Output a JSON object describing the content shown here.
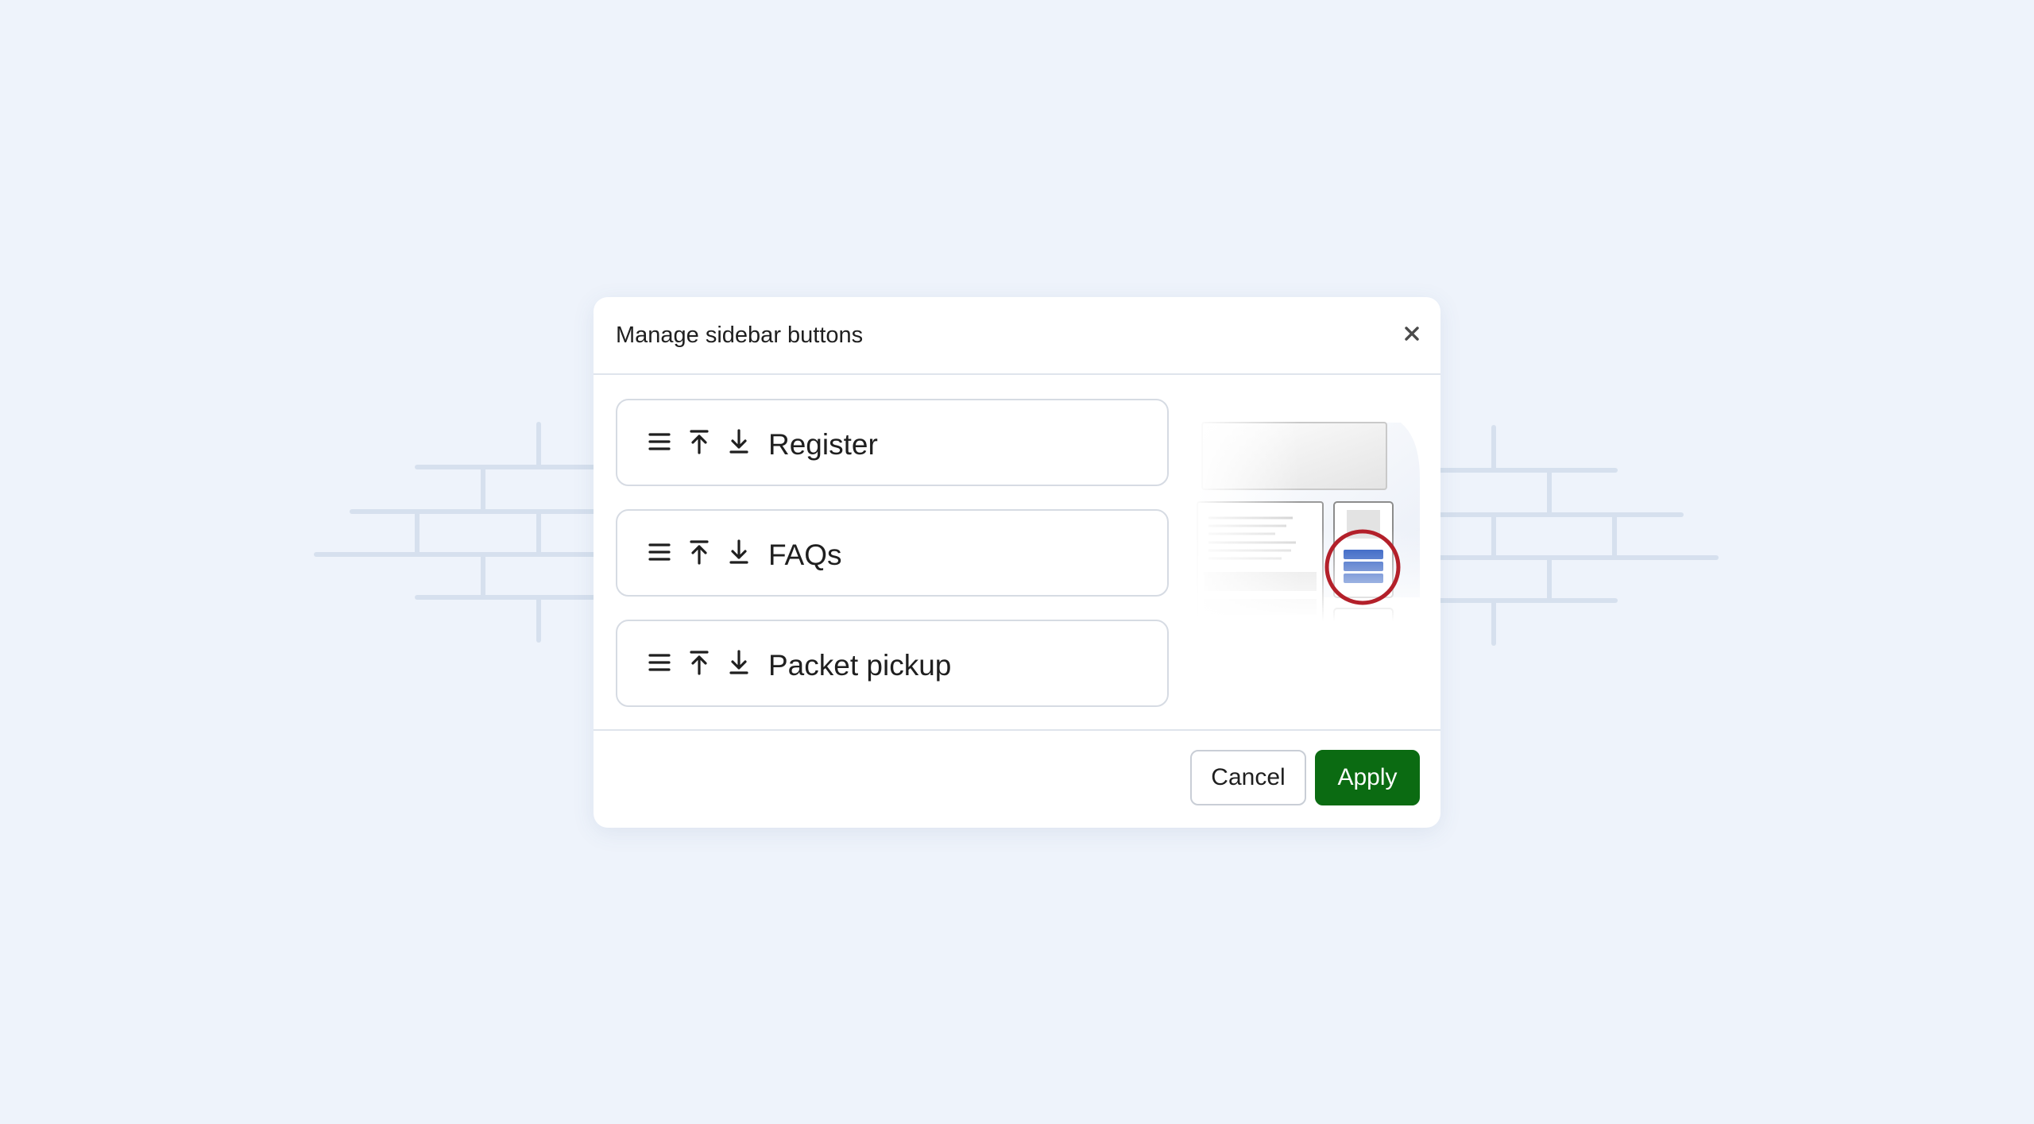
{
  "dialog": {
    "title": "Manage sidebar buttons",
    "close_icon": "close-icon"
  },
  "items": [
    {
      "label": "Register"
    },
    {
      "label": "FAQs"
    },
    {
      "label": "Packet pickup"
    }
  ],
  "item_icons": [
    "drag-handle-icon",
    "move-to-top-icon",
    "move-to-bottom-icon"
  ],
  "footer": {
    "cancel_label": "Cancel",
    "apply_label": "Apply"
  },
  "colors": {
    "background": "#eef3fb",
    "apply": "#0b6b12",
    "highlight_ring": "#b3202a",
    "sidebar_icon": "#0d43b8"
  }
}
